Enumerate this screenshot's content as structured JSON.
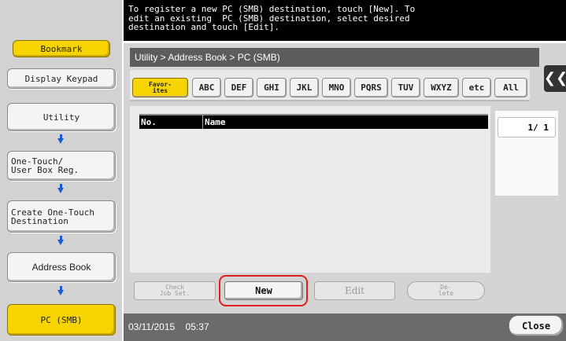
{
  "sidebar": {
    "bookmark": "Bookmark",
    "display_keypad": "Display Keypad",
    "utility": "Utility",
    "one_touch": "One-Touch/\nUser Box Reg.",
    "create_dest": "Create One-Touch\nDestination",
    "address_book": "Address Book",
    "pc_smb": "PC (SMB)"
  },
  "message": "To register a new PC (SMB) destination, touch [New]. To\nedit an existing  PC (SMB) destination, select desired\ndestination and touch [Edit].",
  "breadcrumb": "Utility > Address Book > PC (SMB)",
  "tabs": [
    "Favor-\nites",
    "ABC",
    "DEF",
    "GHI",
    "JKL",
    "MNO",
    "PQRS",
    "TUV",
    "WXYZ",
    "etc",
    "All"
  ],
  "list": {
    "col_no": "No.",
    "col_name": "Name"
  },
  "page_indicator": "1/  1",
  "actions": {
    "check_job": "Check\nJob Set.",
    "new": "New",
    "edit": "Edit",
    "delete": "De-\nlete"
  },
  "footer": {
    "date": "03/11/2015",
    "time": "05:37",
    "close": "Close"
  },
  "icons": {
    "collapse": "double-chevron-left-icon",
    "arrow": "arrow-down-icon"
  },
  "colors": {
    "accent": "#f5d400",
    "arrow": "#1a5ad8",
    "highlight": "#e02020"
  }
}
